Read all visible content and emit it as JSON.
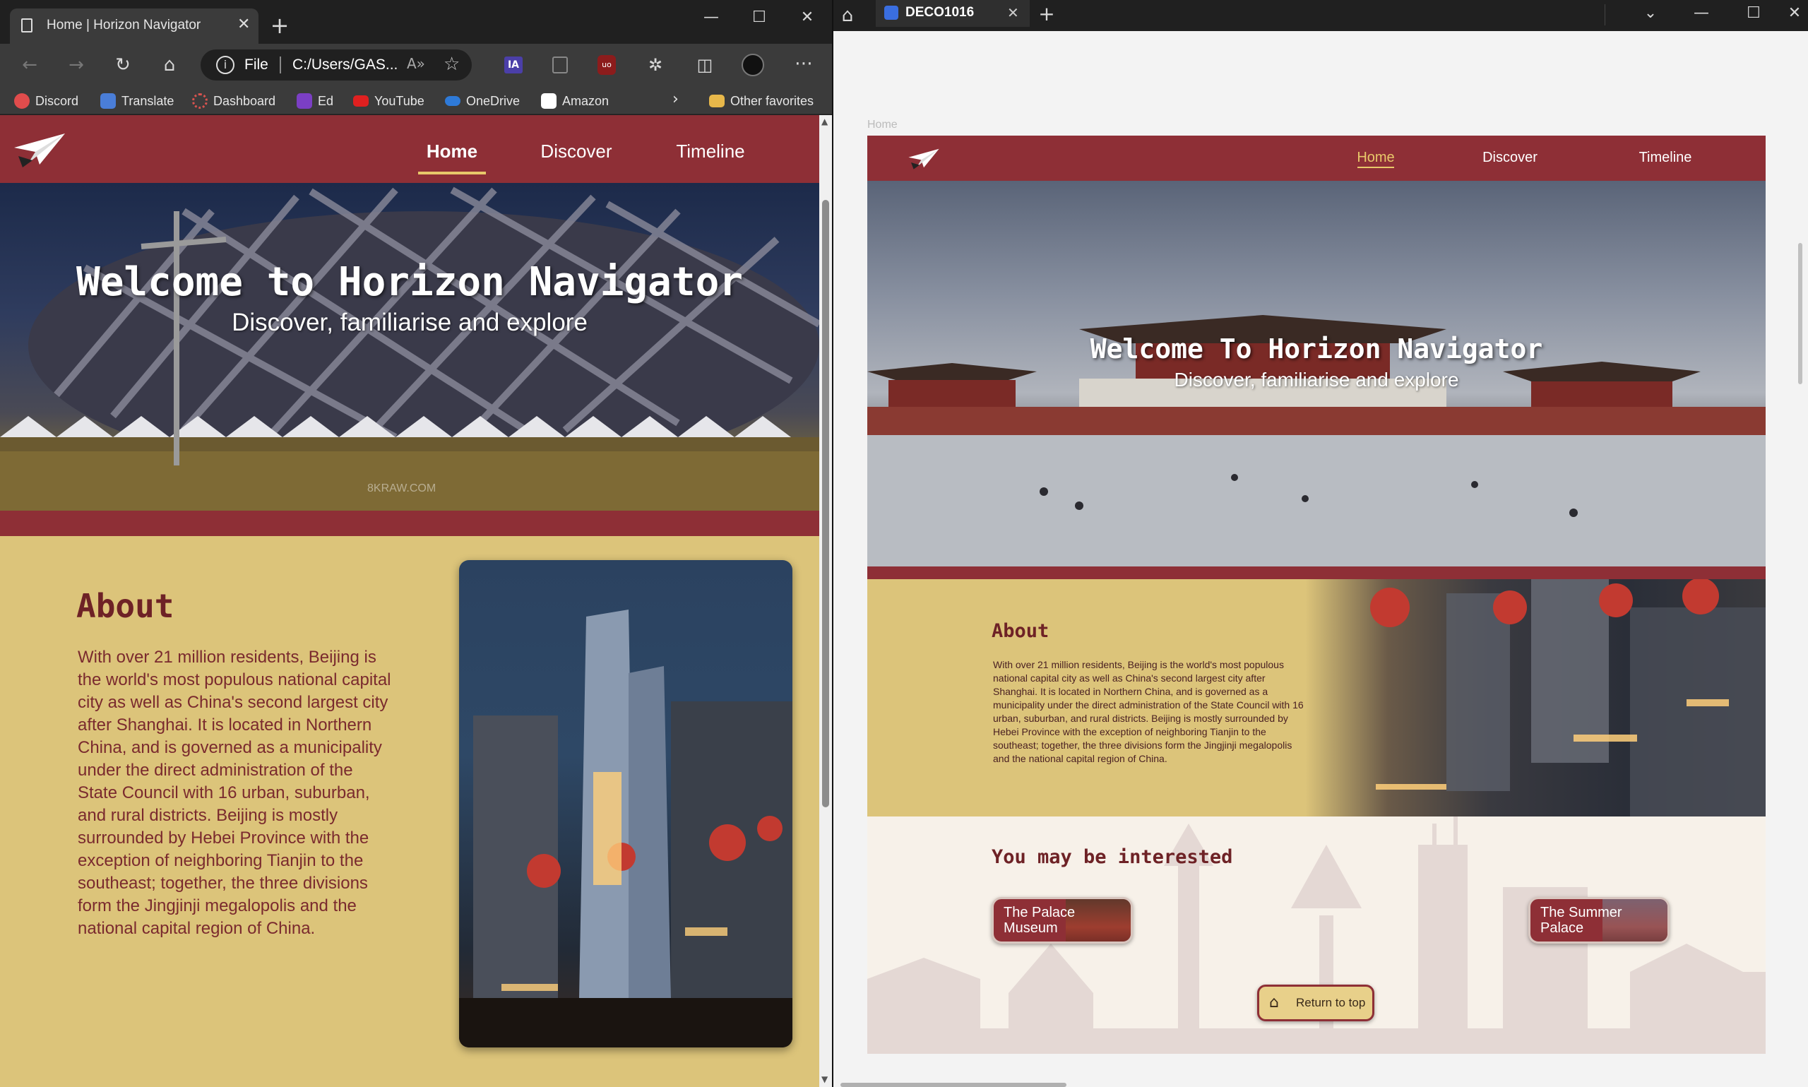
{
  "left_browser": {
    "tab_title": "Home | Horizon Navigator",
    "address_scheme": "File",
    "address_path": "C:/Users/GAS...",
    "favorites": [
      "Discord",
      "Translate",
      "Dashboard",
      "Ed",
      "YouTube",
      "OneDrive",
      "Amazon"
    ],
    "other_favorites": "Other favorites",
    "site": {
      "nav": [
        "Home",
        "Discover",
        "Timeline"
      ],
      "hero_title": "Welcome to Horizon Navigator",
      "hero_subtitle": "Discover, familiarise and explore",
      "watermark": "8KRAW.COM",
      "about_heading": "About",
      "about_text": "With over 21 million residents, Beijing is the world's most populous national capital city as well as China's second largest city after Shanghai. It is located in Northern China, and is governed as a municipality under the direct administration of the State Council with 16 urban, suburban, and rural districts. Beijing is mostly surrounded by Hebei Province with the exception of neighboring Tianjin to the southeast; together, the three divisions form the Jingjinji megalopolis and the national capital region of China."
    }
  },
  "right_browser": {
    "tab_title": "DECO1016",
    "breadcrumb": "Home",
    "site": {
      "nav": [
        "Home",
        "Discover",
        "Timeline"
      ],
      "hero_title": "Welcome To Horizon Navigator",
      "hero_subtitle": "Discover, familiarise and explore",
      "about_heading": "About",
      "about_text": "With over 21 million residents, Beijing is the world's most populous national capital city as well as China's second largest city after Shanghai. It is located in Northern China, and is governed as a municipality under the direct administration of the State Council with 16 urban, suburban, and rural districts. Beijing is mostly surrounded by Hebei Province with the exception of neighboring Tianjin to the southeast; together, the three divisions form the Jingjinji megalopolis and the national capital region of China.",
      "interested_heading": "You may be interested",
      "card_palace_line1": "The Palace",
      "card_palace_line2": "Museum",
      "card_summer_line1": "The Summer",
      "card_summer_line2": "Palace",
      "return_top": "Return to top"
    }
  },
  "colors": {
    "brand_red": "#8e2f36",
    "sand": "#dcc47a",
    "cream": "#f7f1e9",
    "gold_active": "#e8c86a"
  }
}
